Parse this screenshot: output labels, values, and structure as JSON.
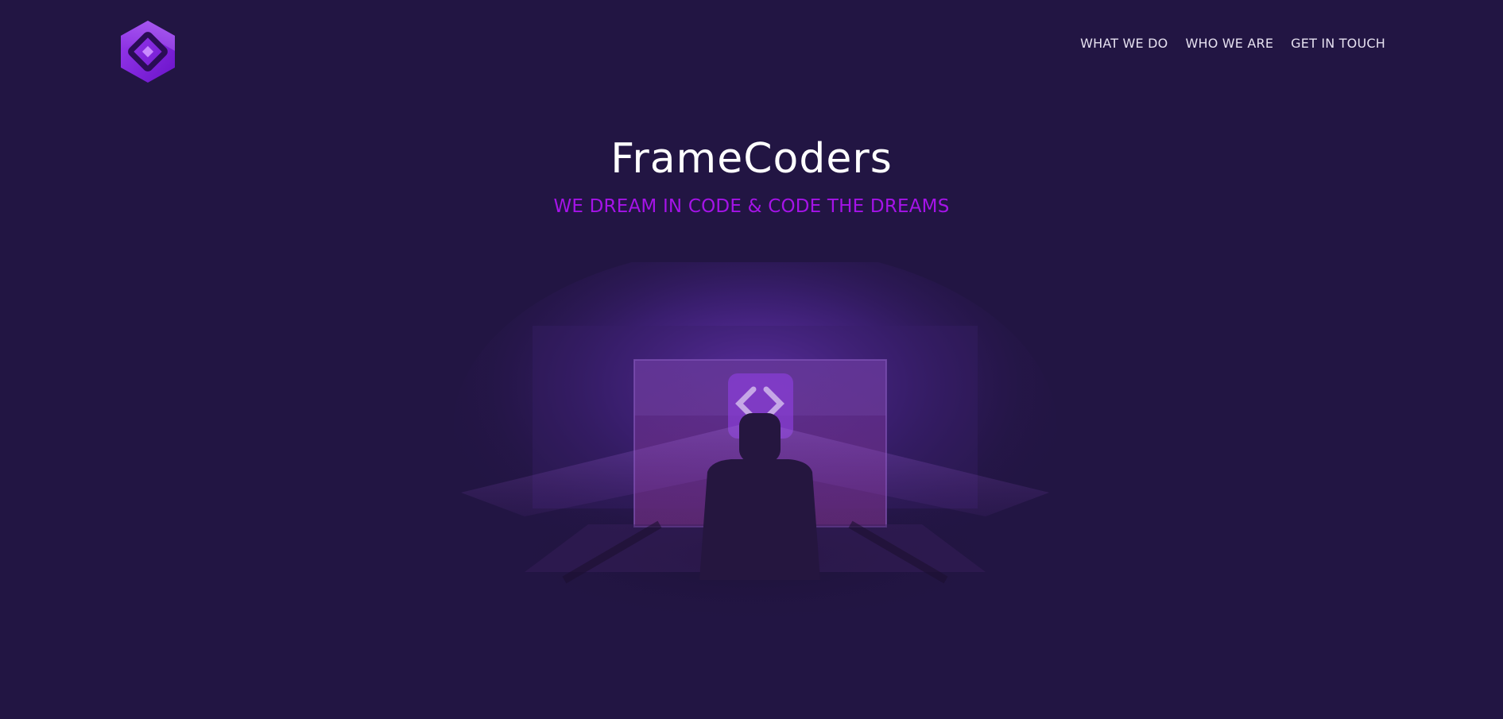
{
  "brand": {
    "logo_icon": "framecoders-logo-icon",
    "accent_color": "#a513e8",
    "background_color": "#221543"
  },
  "nav": {
    "items": [
      {
        "label": "WHAT WE DO"
      },
      {
        "label": "WHO WE ARE"
      },
      {
        "label": "GET IN TOUCH"
      }
    ]
  },
  "hero": {
    "title": "FrameCoders",
    "tagline": "WE DREAM IN CODE & CODE THE DREAMS",
    "illustration_icon": "coder-at-screen-illustration"
  }
}
